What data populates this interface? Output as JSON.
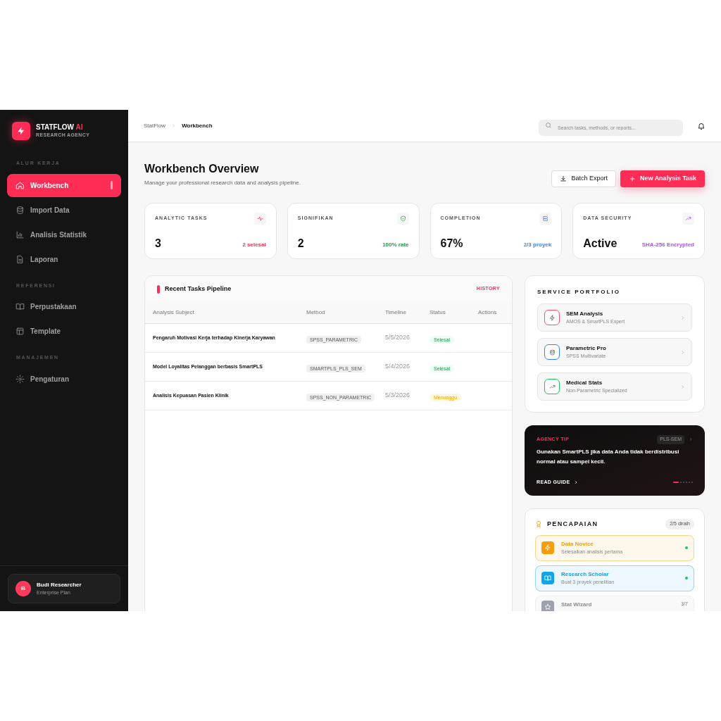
{
  "brand": {
    "name": "STATFLOW",
    "accent": "AI",
    "tagline": "RESEARCH AGENCY"
  },
  "sidebar": {
    "sections": [
      {
        "title": "ALUR KERJA",
        "items": [
          {
            "kind": "home",
            "label": "Workbench",
            "selected": true
          },
          {
            "kind": "database",
            "label": "Import Data",
            "selected": false
          },
          {
            "kind": "chart",
            "label": "Analisis Statistik",
            "selected": false
          },
          {
            "kind": "file",
            "label": "Laporan",
            "selected": false
          }
        ]
      },
      {
        "title": "REFERENSI",
        "items": [
          {
            "kind": "book",
            "label": "Perpustakaan",
            "selected": false
          },
          {
            "kind": "layout",
            "label": "Template",
            "selected": false
          }
        ]
      },
      {
        "title": "MANAJEMEN",
        "items": [
          {
            "kind": "gear",
            "label": "Pengaturan",
            "selected": false
          }
        ]
      }
    ]
  },
  "user": {
    "initial": "B",
    "name": "Budi Researcher",
    "plan": "Enterprise Plan"
  },
  "breadcrumb": [
    "StatFlow",
    "Workbench"
  ],
  "search": {
    "placeholder": "Search tasks, methods, or reports..."
  },
  "page": {
    "title": "Workbench Overview",
    "subtitle": "Manage your professional research data and analysis pipeline.",
    "buttons": [
      {
        "kind": "export",
        "label": "Batch Export"
      },
      {
        "kind": "primary",
        "label": "New Analysis Task"
      }
    ]
  },
  "stats": [
    {
      "kind": "pulse",
      "label": "ANALYTIC TASKS",
      "value": "3",
      "note": "2 selesai",
      "color": "#ff2d55"
    },
    {
      "kind": "shield",
      "label": "SIGNIFIKAN",
      "value": "2",
      "note": "100% rate",
      "color": "#16a34a"
    },
    {
      "kind": "server",
      "label": "COMPLETION",
      "value": "67%",
      "note": "2/3 proyek",
      "color": "#3b82f6"
    },
    {
      "kind": "trend",
      "label": "DATA SECURITY",
      "value": "Active",
      "note": "SHA-256 Encrypted",
      "color": "#a855f7"
    }
  ],
  "table": {
    "title": "Recent Tasks Pipeline",
    "link": "HISTORY",
    "columns": [
      "Analysis Subject",
      "Method",
      "Timeline",
      "Status",
      "Actions"
    ],
    "rows": [
      {
        "subject": "Pengaruh Motivasi Kerja terhadap Kinerja Karyawan",
        "method": "SPSS_PARAMETRIC",
        "timeline": "5/5/2026",
        "status": "Selesai",
        "kind": "done"
      },
      {
        "subject": "Model Loyalitas Pelanggan berbasis SmartPLS",
        "method": "SMARTPLS_PLS_SEM",
        "timeline": "5/4/2026",
        "status": "Selesai",
        "kind": "done"
      },
      {
        "subject": "Analisis Kepuasan Pasien Klinik",
        "method": "SPSS_NON_PARAMETRIC",
        "timeline": "5/3/2026",
        "status": "Menunggu",
        "kind": "pending"
      }
    ]
  },
  "services": {
    "title": "SERVICE PORTFOLIO",
    "items": [
      {
        "kind": "bolt",
        "name": "SEM Analysis",
        "detail": "AMOS & SmartPLS Expert",
        "color": "#ff4d6d"
      },
      {
        "kind": "database",
        "name": "Parametric Pro",
        "detail": "SPSS Multivariate",
        "color": "#3b82f6"
      },
      {
        "kind": "trend",
        "name": "Medical Stats",
        "detail": "Non-Parametric Specialized",
        "color": "#22c55e"
      }
    ]
  },
  "tip": {
    "label": "AGENCY TIP",
    "tag": "PLS-SEM",
    "text": "Gunakan SmartPLS jika data Anda tidak berdistribusi normal atau sampel kecil.",
    "link": "READ GUIDE",
    "slides": [
      {
        "selected": true
      },
      {
        "selected": false
      },
      {
        "selected": false
      },
      {
        "selected": false
      },
      {
        "selected": false
      },
      {
        "selected": false
      }
    ]
  },
  "achievements": {
    "title": "PENCAPAIAN",
    "count": "2/5 diraih",
    "items": [
      {
        "kind": "bolt",
        "name": "Data Novice",
        "detail": "Selesaikan analisis pertama",
        "unlocked": true,
        "color": "#f59e0b"
      },
      {
        "kind": "book",
        "name": "Research Scholar",
        "detail": "Buat 3 proyek penelitian",
        "unlocked": true,
        "color": "#0ea5e9"
      },
      {
        "kind": "star",
        "name": "Stat Wizard",
        "progress": "3/7",
        "unlocked": false,
        "color": "#9ca3af"
      }
    ]
  }
}
